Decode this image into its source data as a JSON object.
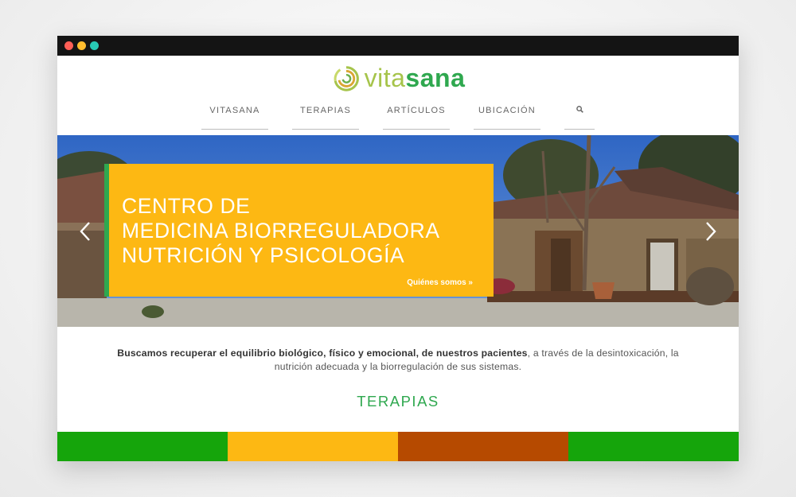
{
  "colors": {
    "brand_green": "#2fa84f",
    "brand_light_green": "#a6c44b",
    "accent_yellow": "#fdb813",
    "accent_brown": "#b64a00",
    "bar_green": "#15a50b"
  },
  "window": {
    "controls": [
      "close",
      "minimize",
      "maximize"
    ]
  },
  "logo": {
    "part1": "vita",
    "part2": "sana",
    "icon": "spiral-logo-icon"
  },
  "nav": {
    "items": [
      {
        "label": "VITASANA"
      },
      {
        "label": "TERAPIAS"
      },
      {
        "label": "ARTÍCULOS"
      },
      {
        "label": "UBICACIÓN"
      }
    ],
    "search_icon": "search-icon"
  },
  "hero": {
    "lines": [
      "CENTRO DE",
      "MEDICINA BIORREGULADORA",
      "NUTRICIÓN Y PSICOLOGÍA"
    ],
    "link": "Quiénes somos »",
    "prev_icon": "chevron-left-icon",
    "next_icon": "chevron-right-icon"
  },
  "intro": {
    "bold": "Buscamos recuperar el equilibrio biológico, físico y emocional, de nuestros pacientes",
    "rest_line1": ", a través de la desintoxicación, la",
    "line2": "nutrición adecuada y la biorregulación de sus sistemas."
  },
  "section": {
    "title": "TERAPIAS"
  },
  "therapy_bars": [
    "#15a50b",
    "#fdb813",
    "#b64a00",
    "#15a50b"
  ]
}
